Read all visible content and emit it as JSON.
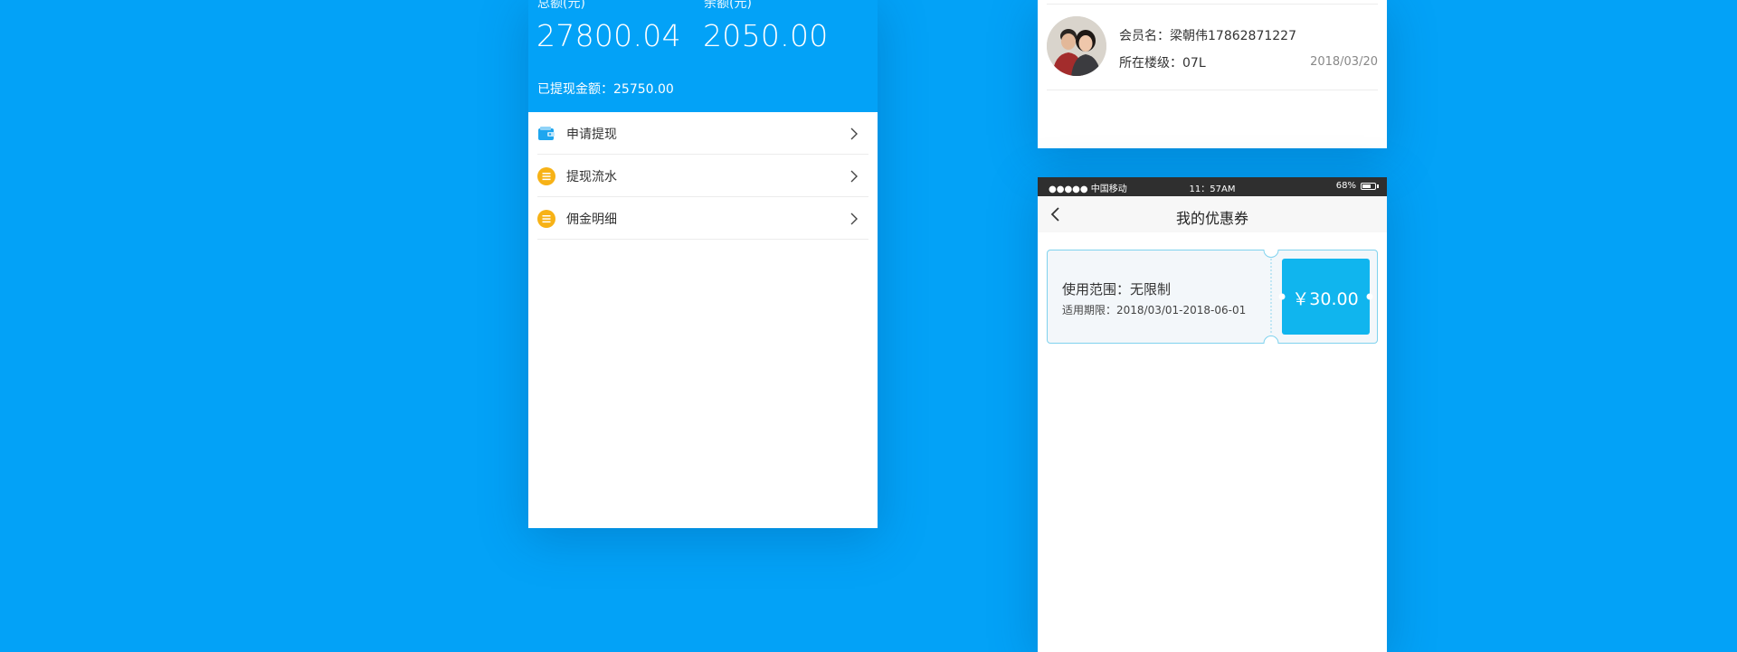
{
  "wallet": {
    "total_label": "总额(元)",
    "total_value": "27800.04",
    "balance_label": "余额(元)",
    "balance_value": "2050.00",
    "withdrawn_label": "已提现金额：25750.00"
  },
  "menu": {
    "items": [
      {
        "label": "申请提现",
        "icon": "wallet-icon"
      },
      {
        "label": "提现流水",
        "icon": "list-icon"
      },
      {
        "label": "佣金明细",
        "icon": "list-icon"
      }
    ]
  },
  "member": {
    "name": "会员名：梁朝伟17862871227",
    "floor": "所在楼级：07L",
    "date": "2018/03/20"
  },
  "status_bar": {
    "carrier": "●●●●● 中国移动",
    "time": "11：57AM",
    "battery": "68%",
    "battery_level": 0.68
  },
  "coupon_page": {
    "title": "我的优惠券",
    "coupon": {
      "scope": "使用范围：无限制",
      "validity": "适用期限：2018/03/01-2018-06-01",
      "amount": "￥30.00"
    }
  },
  "colors": {
    "brand_blue": "#03a2f7",
    "coupon_blue": "#10b5ee",
    "icon_orange": "#f7b216"
  }
}
